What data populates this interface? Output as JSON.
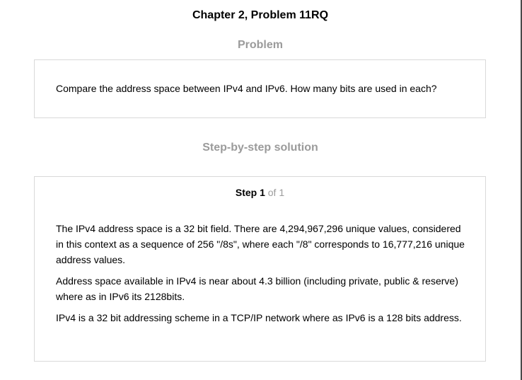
{
  "page": {
    "title": "Chapter 2, Problem 11RQ"
  },
  "problem": {
    "heading": "Problem",
    "text": "Compare the address space between IPv4 and IPv6. How many bits are used in each?"
  },
  "solution": {
    "heading": "Step-by-step solution",
    "step_label": "Step 1",
    "step_count": "of 1",
    "paragraphs": [
      "The IPv4 address space is a 32 bit field. There are 4,294,967,296 unique values, considered in this context as a sequence of 256 \"/8s\", where each \"/8\" corresponds to 16,777,216 unique address values.",
      "Address space available in IPv4 is near about 4.3 billion (including private, public & reserve) where as in IPv6 its 2128bits.",
      "IPv4 is a 32 bit addressing scheme in a TCP/IP network where as IPv6 is a 128 bits address."
    ]
  },
  "colors": {
    "heading_gray": "#9b9b9b",
    "box_border": "#d9d9d9",
    "text": "#000000"
  }
}
